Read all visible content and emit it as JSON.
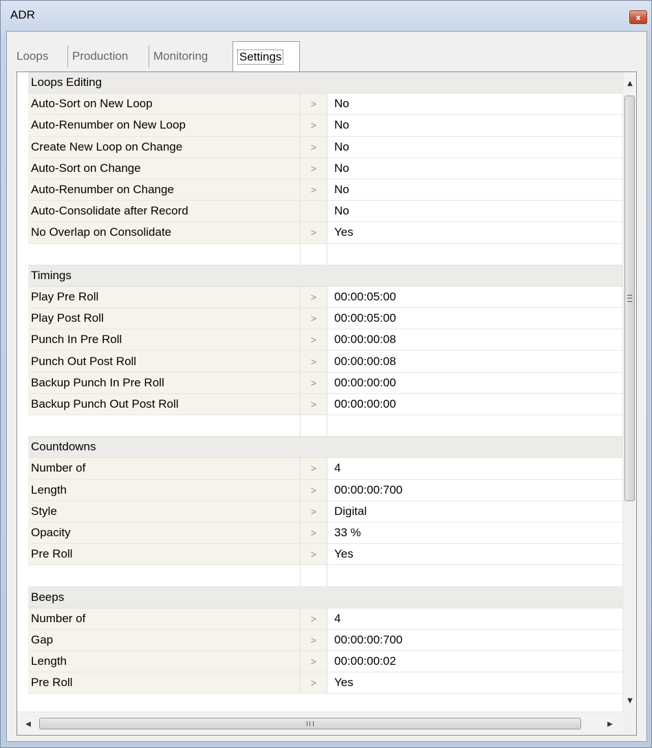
{
  "window": {
    "title": "ADR",
    "close_label": "x"
  },
  "tabs": [
    {
      "label": "Loops",
      "active": false
    },
    {
      "label": "Production",
      "active": false
    },
    {
      "label": "Monitoring",
      "active": false
    },
    {
      "label": "Settings",
      "active": true
    }
  ],
  "sections": [
    {
      "title": "Loops Editing",
      "rows": [
        {
          "label": "Auto-Sort on New Loop",
          "arrow": ">",
          "value": "No"
        },
        {
          "label": "Auto-Renumber on New Loop",
          "arrow": ">",
          "value": "No"
        },
        {
          "label": "Create New Loop on Change",
          "arrow": ">",
          "value": "No"
        },
        {
          "label": "Auto-Sort on Change",
          "arrow": ">",
          "value": "No"
        },
        {
          "label": "Auto-Renumber on Change",
          "arrow": ">",
          "value": "No"
        },
        {
          "label": "Auto-Consolidate after Record",
          "arrow": "",
          "value": "No"
        },
        {
          "label": "No Overlap on Consolidate",
          "arrow": ">",
          "value": "Yes"
        }
      ]
    },
    {
      "title": "Timings",
      "rows": [
        {
          "label": "Play Pre Roll",
          "arrow": ">",
          "value": "00:00:05:00"
        },
        {
          "label": "Play Post Roll",
          "arrow": ">",
          "value": "00:00:05:00"
        },
        {
          "label": "Punch In Pre Roll",
          "arrow": ">",
          "value": "00:00:00:08"
        },
        {
          "label": "Punch Out Post Roll",
          "arrow": ">",
          "value": "00:00:00:08"
        },
        {
          "label": "Backup Punch In Pre Roll",
          "arrow": ">",
          "value": "00:00:00:00"
        },
        {
          "label": "Backup Punch Out Post Roll",
          "arrow": ">",
          "value": "00:00:00:00"
        }
      ]
    },
    {
      "title": "Countdowns",
      "rows": [
        {
          "label": "Number of",
          "arrow": ">",
          "value": "4"
        },
        {
          "label": "Length",
          "arrow": ">",
          "value": "00:00:00:700"
        },
        {
          "label": "Style",
          "arrow": ">",
          "value": "Digital"
        },
        {
          "label": "Opacity",
          "arrow": ">",
          "value": "33 %"
        },
        {
          "label": "Pre Roll",
          "arrow": ">",
          "value": "Yes"
        }
      ]
    },
    {
      "title": "Beeps",
      "rows": [
        {
          "label": "Number of",
          "arrow": ">",
          "value": "4"
        },
        {
          "label": "Gap",
          "arrow": ">",
          "value": "00:00:00:700"
        },
        {
          "label": "Length",
          "arrow": ">",
          "value": "00:00:00:02"
        },
        {
          "label": "Pre Roll",
          "arrow": ">",
          "value": "Yes"
        }
      ]
    }
  ],
  "scroll_icons": {
    "up": "arrow-up-icon",
    "down": "arrow-down-icon",
    "left": "arrow-left-icon",
    "right": "arrow-right-icon"
  }
}
